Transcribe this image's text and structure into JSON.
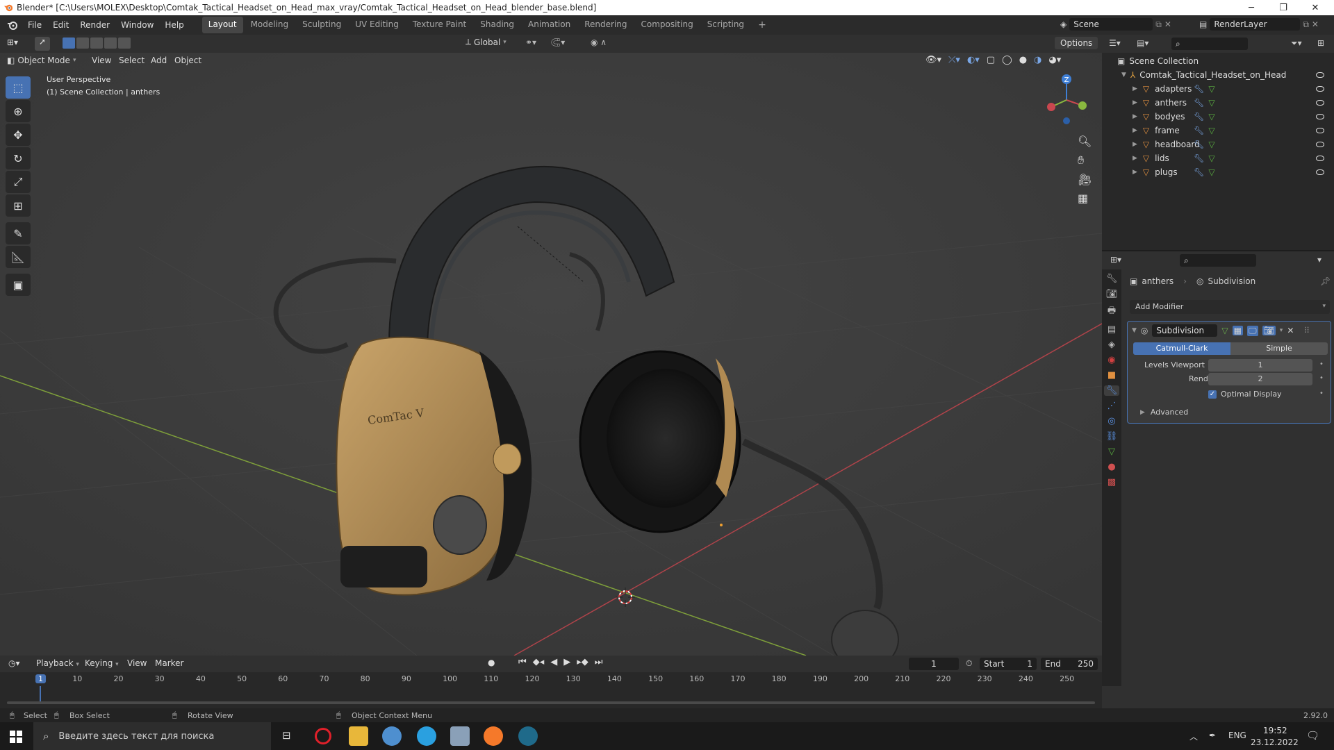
{
  "window": {
    "title": "Blender* [C:\\Users\\MOLEX\\Desktop\\Comtak_Tactical_Headset_on_Head_max_vray/Comtak_Tactical_Headset_on_Head_blender_base.blend]",
    "minimize": "─",
    "maximize": "❐",
    "close": "✕"
  },
  "menu": [
    "File",
    "Edit",
    "Render",
    "Window",
    "Help"
  ],
  "workspaces": [
    "Layout",
    "Modeling",
    "Sculpting",
    "UV Editing",
    "Texture Paint",
    "Shading",
    "Animation",
    "Rendering",
    "Compositing",
    "Scripting"
  ],
  "workspace_active": "Layout",
  "workspace_add": "+",
  "scene": {
    "name": "Scene",
    "view_layer": "RenderLayer"
  },
  "viewport_header": {
    "mode": "Object Mode",
    "menus": [
      "View",
      "Select",
      "Add",
      "Object"
    ],
    "transform_orientation": "Global",
    "options": "Options"
  },
  "viewport": {
    "perspective": "User Perspective",
    "collection_info": "(1) Scene Collection | anthers",
    "product_label": "ComTac V",
    "gizmo_axis": {
      "z": "Z",
      "x": "X",
      "y": "Y"
    }
  },
  "outliner": {
    "root": "Scene Collection",
    "collection": "Comtak_Tactical_Headset_on_Head",
    "objects": [
      "adapters",
      "anthers",
      "bodyes",
      "frame",
      "headboard",
      "lids",
      "plugs"
    ],
    "selected": "anthers"
  },
  "properties": {
    "object": "anthers",
    "modifier_context": "Subdivision",
    "add_modifier": "Add Modifier",
    "modifier": {
      "name": "Subdivision",
      "type_options": [
        "Catmull-Clark",
        "Simple"
      ],
      "type_active": "Catmull-Clark",
      "levels_viewport_label": "Levels Viewport",
      "levels_viewport": "1",
      "render_label": "Render",
      "render": "2",
      "optimal_display_label": "Optimal Display",
      "optimal_display": true,
      "advanced": "Advanced"
    }
  },
  "timeline": {
    "menus": [
      "Playback",
      "Keying",
      "View",
      "Marker"
    ],
    "current_frame": "1",
    "start_label": "Start",
    "start": "1",
    "end_label": "End",
    "end": "250",
    "ticks": [
      "1",
      "10",
      "20",
      "30",
      "40",
      "50",
      "60",
      "70",
      "80",
      "90",
      "100",
      "110",
      "120",
      "130",
      "140",
      "150",
      "160",
      "170",
      "180",
      "190",
      "200",
      "210",
      "220",
      "230",
      "240",
      "250"
    ]
  },
  "statusbar": {
    "select": "Select",
    "box_select": "Box Select",
    "rotate_view": "Rotate View",
    "context_menu": "Object Context Menu",
    "version": "2.92.0"
  },
  "taskbar": {
    "search_placeholder": "Введите здесь текст для поиска",
    "lang": "ENG",
    "time": "19:52",
    "date": "23.12.2022"
  },
  "colors": {
    "accent": "#4772b3",
    "x_axis": "#c9474f",
    "y_axis": "#8ab83f",
    "z_axis": "#3f7fd6",
    "headset_tan": "#b08a52"
  }
}
